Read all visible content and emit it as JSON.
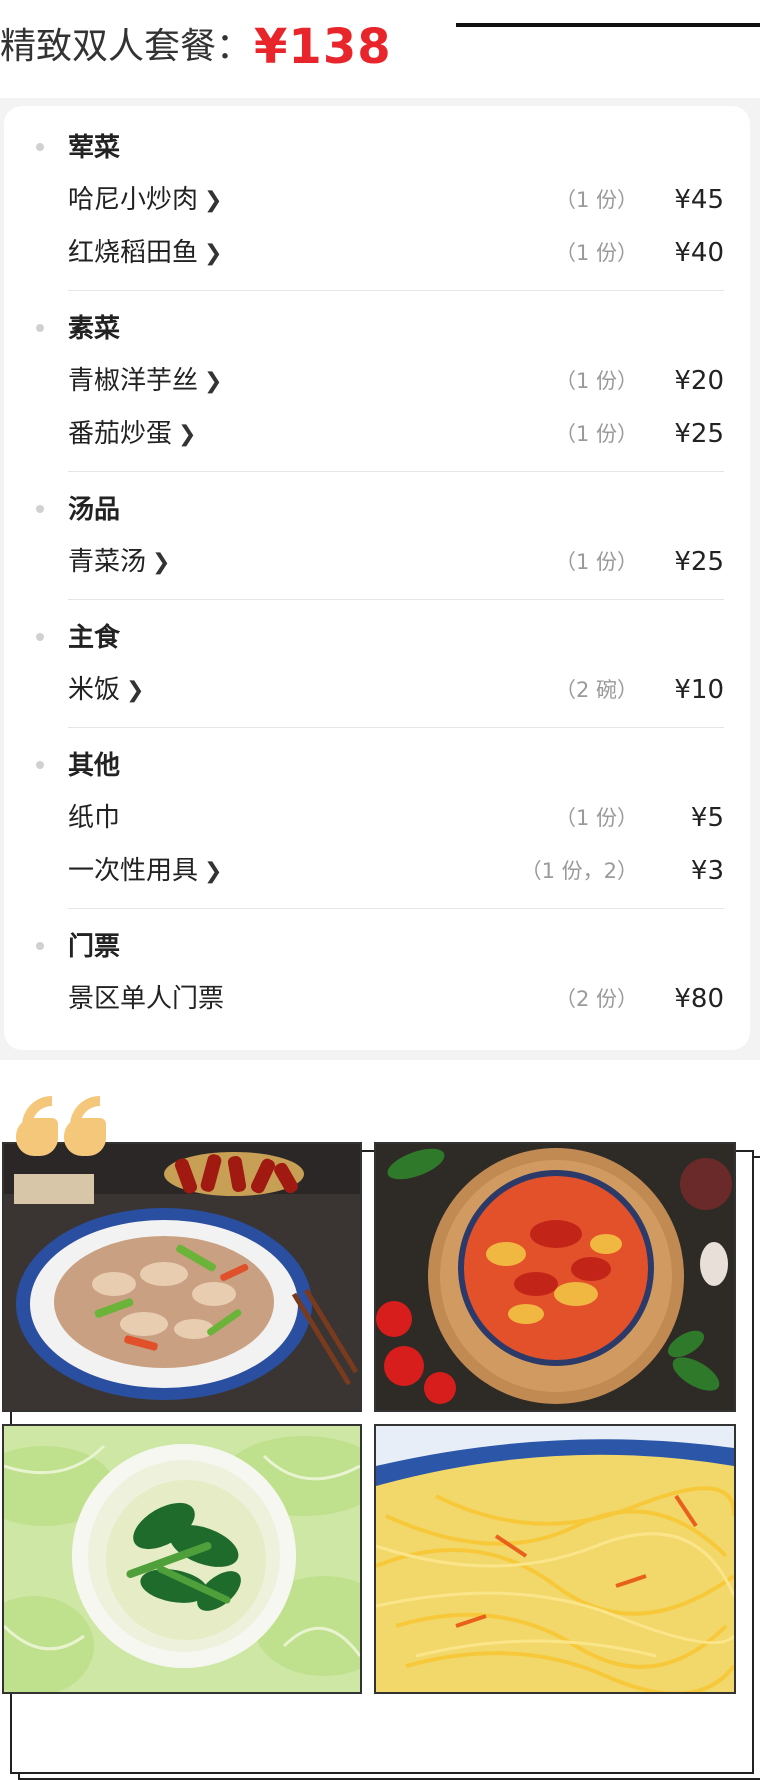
{
  "header": {
    "title": "精致双人套餐：",
    "price": "¥138",
    "price_color": "#e8252b"
  },
  "menu": {
    "sections": [
      {
        "title": "荤菜",
        "items": [
          {
            "name": "哈尼小炒肉",
            "has_link": true,
            "qty": "（1 份）",
            "price": "¥45"
          },
          {
            "name": "红烧稻田鱼",
            "has_link": true,
            "qty": "（1 份）",
            "price": "¥40"
          }
        ]
      },
      {
        "title": "素菜",
        "items": [
          {
            "name": "青椒洋芋丝",
            "has_link": true,
            "qty": "（1 份）",
            "price": "¥20"
          },
          {
            "name": "番茄炒蛋",
            "has_link": true,
            "qty": "（1 份）",
            "price": "¥25"
          }
        ]
      },
      {
        "title": "汤品",
        "items": [
          {
            "name": "青菜汤",
            "has_link": true,
            "qty": "（1 份）",
            "price": "¥25"
          }
        ]
      },
      {
        "title": "主食",
        "items": [
          {
            "name": "米饭",
            "has_link": true,
            "qty": "（2 碗）",
            "price": "¥10"
          }
        ]
      },
      {
        "title": "其他",
        "items": [
          {
            "name": "纸巾",
            "has_link": false,
            "qty": "（1 份）",
            "price": "¥5"
          },
          {
            "name": "一次性用具",
            "has_link": true,
            "qty": "（1 份，2）",
            "price": "¥3"
          }
        ]
      },
      {
        "title": "门票",
        "items": [
          {
            "name": "景区单人门票",
            "has_link": false,
            "qty": "（2 份）",
            "price": "¥80"
          }
        ]
      }
    ]
  },
  "gallery": {
    "quote_icon": "quote-mark-icon",
    "quote_color": "#f4c77a",
    "photos": [
      {
        "name": "stir-fried-pork-photo"
      },
      {
        "name": "tomato-egg-photo"
      },
      {
        "name": "greens-soup-photo"
      },
      {
        "name": "shredded-potato-photo"
      }
    ]
  }
}
